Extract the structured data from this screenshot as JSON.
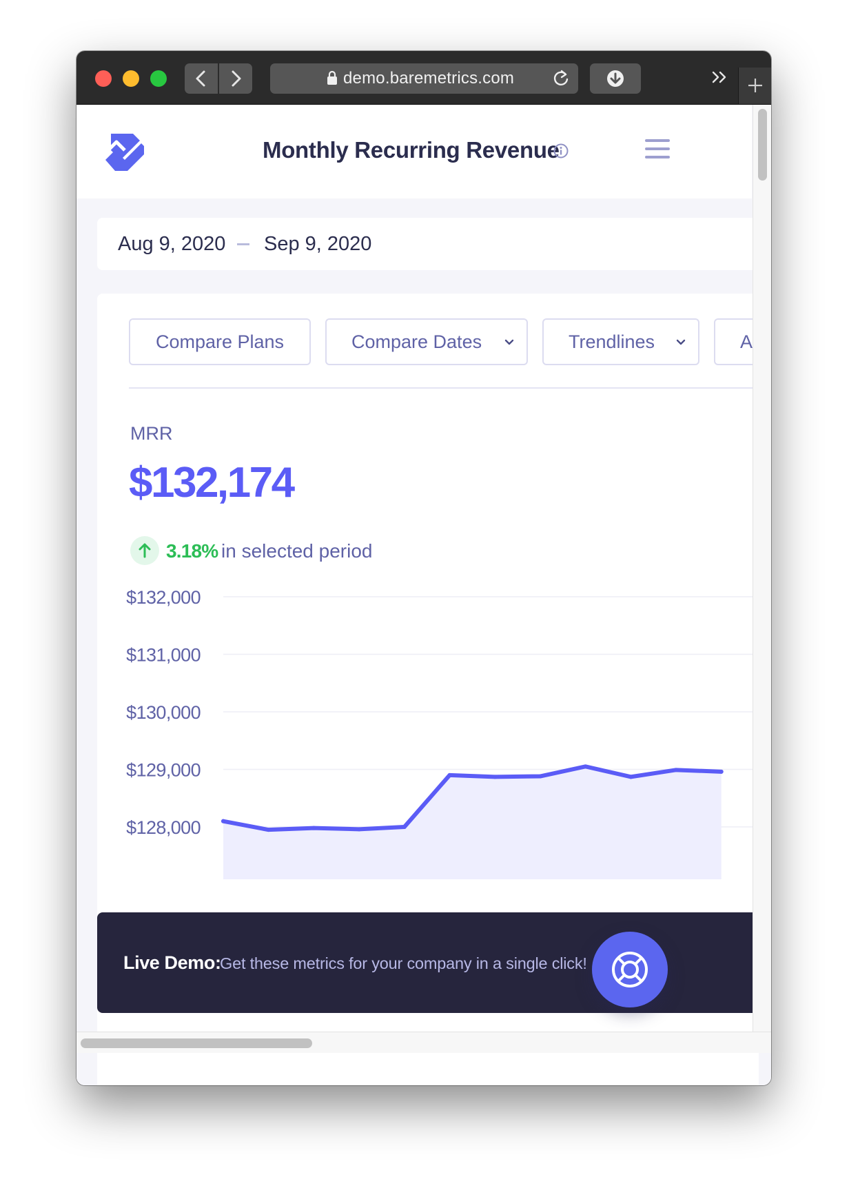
{
  "browser": {
    "url": "demo.baremetrics.com",
    "icons": {
      "back": "chevron-left-icon",
      "forward": "chevron-right-icon",
      "lock": "lock-icon",
      "reload": "reload-icon",
      "download": "download-icon",
      "overflow": "double-chevron-right-icon",
      "new_tab": "plus-icon"
    },
    "back_glyph": "‹",
    "forward_glyph": "›",
    "overflow_glyph": "»",
    "new_tab_glyph": "+"
  },
  "header": {
    "title": "Monthly Recurring Revenue",
    "logo_icon": "baremetrics-logo",
    "info_icon": "info-icon",
    "menu_icon": "hamburger-menu-icon"
  },
  "date_range": {
    "start": "Aug 9, 2020",
    "end": "Sep 9, 2020"
  },
  "toolbar": {
    "compare_plans": "Compare Plans",
    "compare_dates": "Compare Dates",
    "trendlines": "Trendlines",
    "more": "A"
  },
  "metric": {
    "label": "MRR",
    "value": "$132,174",
    "change_pct": "3.18%",
    "change_text": "in selected period",
    "change_icon": "arrow-up-icon"
  },
  "chart_data": {
    "type": "area",
    "ylabel": "",
    "xlabel": "",
    "y_ticks": [
      "$132,000",
      "$131,000",
      "$130,000",
      "$129,000",
      "$128,000"
    ],
    "y_tick_values": [
      132000,
      131000,
      130000,
      129000,
      128000
    ],
    "ylim": [
      127200,
      132000
    ],
    "grid": true,
    "series": [
      {
        "values": [
          128100,
          127950,
          127980,
          127960,
          128000,
          128900,
          128870,
          128880,
          129050,
          128870,
          128990,
          128960
        ]
      }
    ],
    "colors": {
      "line": "#5b5cf6",
      "fill": "#eeeefe",
      "grid": "#eeeef6"
    }
  },
  "banner": {
    "strong": "Live Demo:",
    "text": "Get these metrics for your company in a single click!",
    "help_icon": "lifebuoy-icon"
  },
  "colors": {
    "accent": "#5b5cf6",
    "positive": "#2cbd56",
    "muted_text": "#5f62a6",
    "dark_text": "#2b2d4e",
    "banner_bg": "#26253d",
    "page_bg": "#f5f5fa"
  }
}
